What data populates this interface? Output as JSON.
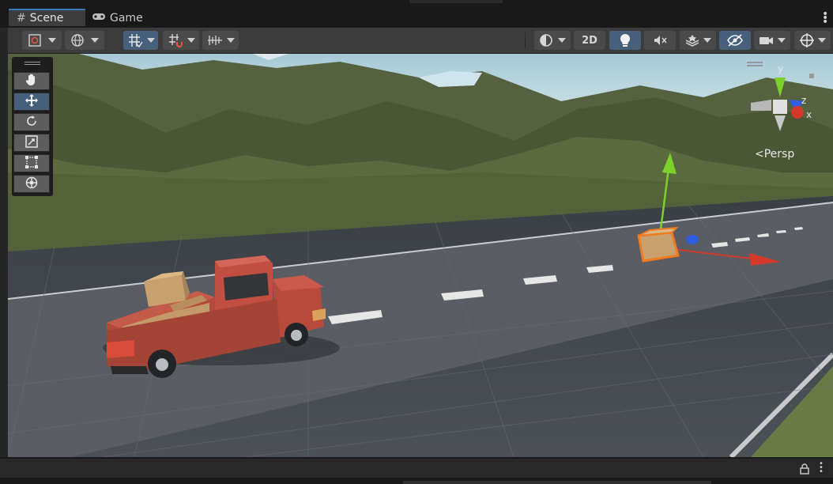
{
  "tabs": [
    {
      "label": "Scene",
      "icon": "grid-hash-icon",
      "active": true
    },
    {
      "label": "Game",
      "icon": "gamepad-icon",
      "active": false
    }
  ],
  "toolbar": {
    "toggle_2d_label": "2D"
  },
  "tools": [
    {
      "name": "hand-tool",
      "active": false
    },
    {
      "name": "move-tool",
      "active": true
    },
    {
      "name": "rotate-tool",
      "active": false
    },
    {
      "name": "scale-tool",
      "active": false
    },
    {
      "name": "rect-tool",
      "active": false
    },
    {
      "name": "transform-tool",
      "active": false
    }
  ],
  "gizmo": {
    "axis_y": "y",
    "axis_z": "z",
    "axis_x": "x",
    "projection_label": "Persp"
  },
  "colors": {
    "active_tab_accent": "#3a79bb",
    "toggle_on": "#46607c",
    "axis_x": "#d43a2a",
    "axis_y": "#7cd02a",
    "axis_z": "#2f5fe0",
    "selection_outline": "#f07a20"
  }
}
